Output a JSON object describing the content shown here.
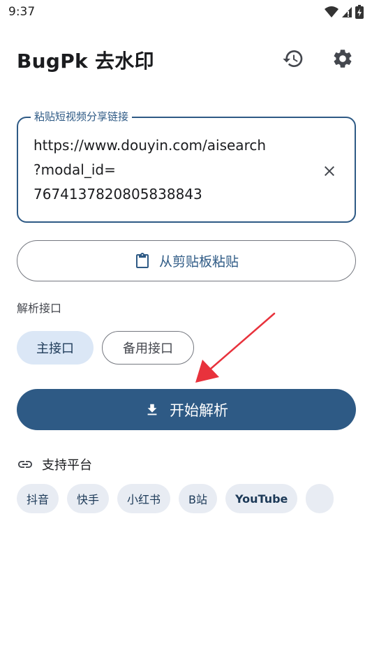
{
  "status_bar": {
    "time": "9:37",
    "icons": [
      "wifi-icon",
      "signal-icon",
      "battery-icon"
    ]
  },
  "app_bar": {
    "title": "BugPk 去水印",
    "actions": [
      "history-icon",
      "settings-icon"
    ]
  },
  "url_input": {
    "label": "粘贴短视频分享链接",
    "value": "https://www.douyin.com/aisearch\n?modal_id=\n7674137820805838843",
    "clear_icon": "close-icon"
  },
  "paste_button": {
    "label": "从剪贴板粘贴",
    "icon": "clipboard-icon"
  },
  "api_section": {
    "label": "解析接口",
    "options": [
      {
        "label": "主接口",
        "selected": true
      },
      {
        "label": "备用接口",
        "selected": false
      }
    ]
  },
  "parse_button": {
    "label": "开始解析",
    "icon": "download-icon"
  },
  "platforms": {
    "title": "支持平台",
    "icon": "link-icon",
    "items": [
      "抖音",
      "快手",
      "小红书",
      "B站",
      "YouTube",
      ""
    ]
  },
  "colors": {
    "primary": "#2e5a85",
    "chip_selected_bg": "#dbe7f6",
    "platform_chip_bg": "#e8ecf3",
    "annotation_arrow": "#e8323c"
  }
}
